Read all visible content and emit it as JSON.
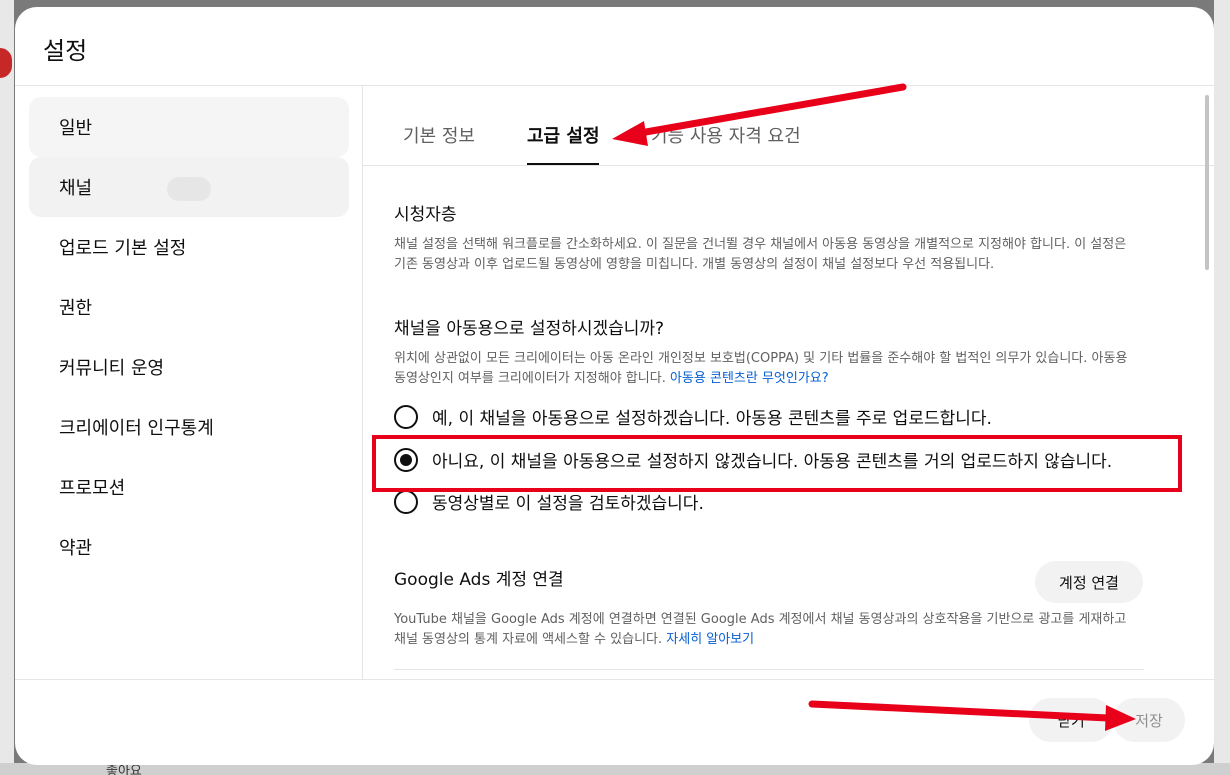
{
  "dialog": {
    "title": "설정"
  },
  "sidebar": {
    "items": [
      {
        "label": "일반"
      },
      {
        "label": "채널"
      },
      {
        "label": "업로드 기본 설정"
      },
      {
        "label": "권한"
      },
      {
        "label": "커뮤니티 운영"
      },
      {
        "label": "크리에이터 인구통계"
      },
      {
        "label": "프로모션"
      },
      {
        "label": "약관"
      }
    ]
  },
  "tabs": [
    {
      "label": "기본 정보"
    },
    {
      "label": "고급 설정"
    },
    {
      "label": "기능 사용 자격 요건"
    }
  ],
  "audience": {
    "title": "시청자층",
    "description": "채널 설정을 선택해 워크플로를 간소화하세요. 이 질문을 건너뛸 경우 채널에서 아동용 동영상을 개별적으로 지정해야 합니다. 이 설정은 기존 동영상과 이후 업로드될 동영상에 영향을 미칩니다. 개별 동영상의 설정이 채널 설정보다 우선 적용됩니다.",
    "question": "채널을 아동용으로 설정하시겠습니까?",
    "coppa_text": "위치에 상관없이 모든 크리에이터는 아동 온라인 개인정보 보호법(COPPA) 및 기타 법률을 준수해야 할 법적인 의무가 있습니다. 아동용 동영상인지 여부를 크리에이터가 지정해야 합니다.",
    "coppa_link": "아동용 콘텐츠란 무엇인가요?",
    "options": [
      {
        "label": "예, 이 채널을 아동용으로 설정하겠습니다. 아동용 콘텐츠를 주로 업로드합니다.",
        "checked": false
      },
      {
        "label": "아니요, 이 채널을 아동용으로 설정하지 않겠습니다. 아동용 콘텐츠를 거의 업로드하지 않습니다.",
        "checked": true
      },
      {
        "label": "동영상별로 이 설정을 검토하겠습니다.",
        "checked": false
      }
    ]
  },
  "google_ads": {
    "title": "Google Ads 계정 연결",
    "button": "계정 연결",
    "description": "YouTube 채널을 Google Ads 계정에 연결하면 연결된 Google Ads 계정에서 채널 동영상과의 상호작용을 기반으로 광고를 게재하고 채널 동영상의 통계 자료에 액세스할 수 있습니다.",
    "link": "자세히 알아보기"
  },
  "footer": {
    "close": "닫기",
    "save": "저장"
  },
  "background": {
    "bottom_text": "좋아요"
  },
  "colors": {
    "annotation_red": "#e8001a",
    "link_blue": "#065fd4"
  }
}
